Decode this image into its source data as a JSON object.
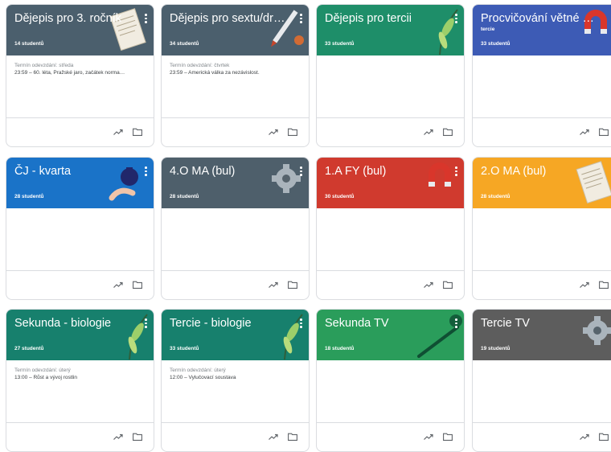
{
  "cards": [
    {
      "id": "c1",
      "title": "Dějepis pro 3. ročník",
      "subtitle": "",
      "count": "14 studentů",
      "color": "#4b5f6d",
      "deco": "paper",
      "due_label": "Termín odevzdání: středa",
      "due_text": "23:59 – 60. léta, Pražské jaro, začátek norma…"
    },
    {
      "id": "c2",
      "title": "Dějepis pro sextu/dru…",
      "subtitle": "",
      "count": "34 studentů",
      "color": "#4b5f6d",
      "deco": "pen",
      "due_label": "Termín odevzdání: čtvrtek",
      "due_text": "23:59 – Americká válka za nezávislost."
    },
    {
      "id": "c3",
      "title": "Dějepis pro tercii",
      "subtitle": "",
      "count": "33 studentů",
      "color": "#1e8e69",
      "deco": "leaf",
      "due_label": "",
      "due_text": ""
    },
    {
      "id": "c4",
      "title": "Procvičování větné s…",
      "subtitle": "tercie",
      "count": "33 studentů",
      "color": "#3d5bb5",
      "deco": "magnet",
      "due_label": "",
      "due_text": ""
    },
    {
      "id": "c5",
      "title": "ČJ - kvarta",
      "subtitle": "",
      "count": "28 studentů",
      "color": "#1a73c8",
      "deco": "ink",
      "due_label": "",
      "due_text": ""
    },
    {
      "id": "c6",
      "title": "4.O MA (bul)",
      "subtitle": "",
      "count": "28 studentů",
      "color": "#4e5f6b",
      "deco": "gear",
      "due_label": "",
      "due_text": ""
    },
    {
      "id": "c7",
      "title": "1.A FY (bul)",
      "subtitle": "",
      "count": "30 studentů",
      "color": "#d03a2e",
      "deco": "magnet",
      "due_label": "",
      "due_text": ""
    },
    {
      "id": "c8",
      "title": "2.O MA (bul)",
      "subtitle": "",
      "count": "28 studentů",
      "color": "#f6a724",
      "deco": "paper",
      "due_label": "",
      "due_text": ""
    },
    {
      "id": "c9",
      "title": "Sekunda - biologie",
      "subtitle": "",
      "count": "27 studentů",
      "color": "#17806d",
      "deco": "leaf",
      "due_label": "Termín odevzdání: úterý",
      "due_text": "13:00 – Růst a vývoj rostlin"
    },
    {
      "id": "c10",
      "title": "Tercie - biologie",
      "subtitle": "",
      "count": "33 studentů",
      "color": "#17806d",
      "deco": "leaf",
      "due_label": "Termín odevzdání: úterý",
      "due_text": "12:00 – Vylučovací soustava"
    },
    {
      "id": "c11",
      "title": "Sekunda TV",
      "subtitle": "",
      "count": "18 studentů",
      "color": "#2a9d5b",
      "deco": "stick",
      "due_label": "",
      "due_text": ""
    },
    {
      "id": "c12",
      "title": "Tercie TV",
      "subtitle": "",
      "count": "19 studentů",
      "color": "#5d5d5d",
      "deco": "gear",
      "due_label": "",
      "due_text": ""
    }
  ]
}
